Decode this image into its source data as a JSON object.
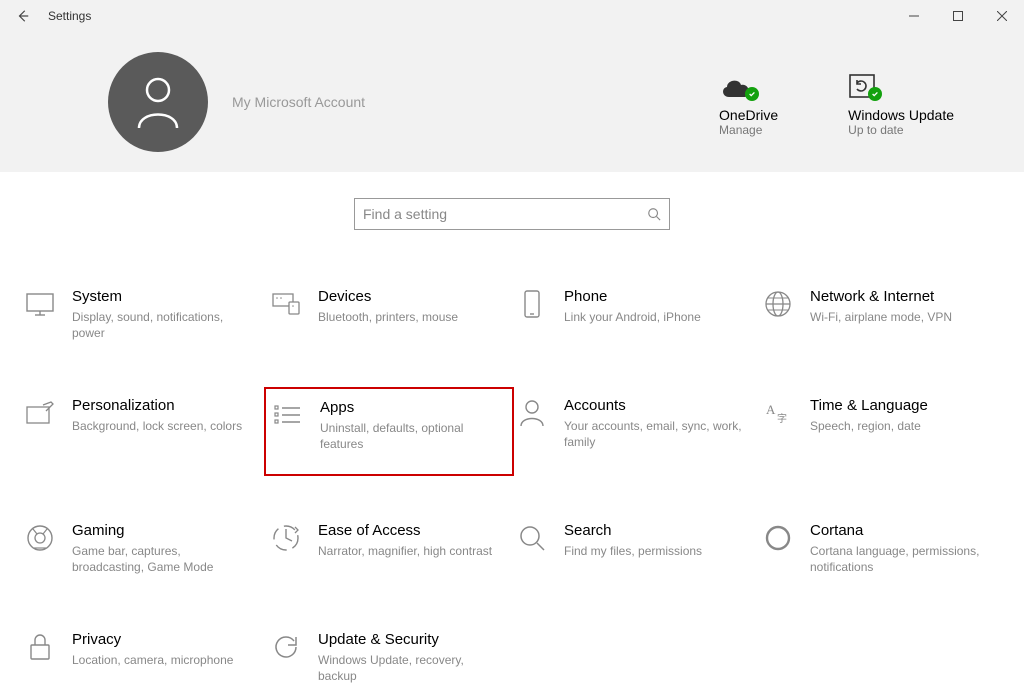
{
  "window": {
    "title": "Settings"
  },
  "account": {
    "name": "My Microsoft Account"
  },
  "header_items": [
    {
      "title": "OneDrive",
      "sub": "Manage"
    },
    {
      "title": "Windows Update",
      "sub": "Up to date"
    }
  ],
  "search": {
    "placeholder": "Find a setting"
  },
  "categories": [
    {
      "name": "system",
      "title": "System",
      "sub": "Display, sound, notifications, power",
      "highlight": false
    },
    {
      "name": "devices",
      "title": "Devices",
      "sub": "Bluetooth, printers, mouse",
      "highlight": false
    },
    {
      "name": "phone",
      "title": "Phone",
      "sub": "Link your Android, iPhone",
      "highlight": false
    },
    {
      "name": "network",
      "title": "Network & Internet",
      "sub": "Wi-Fi, airplane mode, VPN",
      "highlight": false
    },
    {
      "name": "personalization",
      "title": "Personalization",
      "sub": "Background, lock screen, colors",
      "highlight": false
    },
    {
      "name": "apps",
      "title": "Apps",
      "sub": "Uninstall, defaults, optional features",
      "highlight": true
    },
    {
      "name": "accounts",
      "title": "Accounts",
      "sub": "Your accounts, email, sync, work, family",
      "highlight": false
    },
    {
      "name": "time",
      "title": "Time & Language",
      "sub": "Speech, region, date",
      "highlight": false
    },
    {
      "name": "gaming",
      "title": "Gaming",
      "sub": "Game bar, captures, broadcasting, Game Mode",
      "highlight": false
    },
    {
      "name": "ease-of-access",
      "title": "Ease of Access",
      "sub": "Narrator, magnifier, high contrast",
      "highlight": false
    },
    {
      "name": "search",
      "title": "Search",
      "sub": "Find my files, permissions",
      "highlight": false
    },
    {
      "name": "cortana",
      "title": "Cortana",
      "sub": "Cortana language, permissions, notifications",
      "highlight": false
    },
    {
      "name": "privacy",
      "title": "Privacy",
      "sub": "Location, camera, microphone",
      "highlight": false
    },
    {
      "name": "update",
      "title": "Update & Security",
      "sub": "Windows Update, recovery, backup",
      "highlight": false
    }
  ]
}
